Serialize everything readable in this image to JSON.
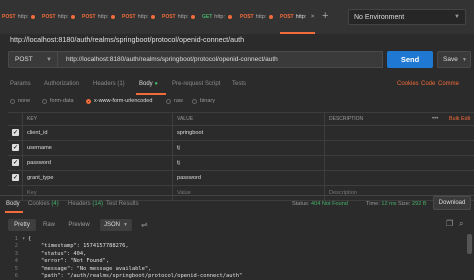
{
  "tabs": [
    {
      "method": "POST",
      "label": "http:"
    },
    {
      "method": "POST",
      "label": "http:"
    },
    {
      "method": "POST",
      "label": "http:"
    },
    {
      "method": "POST",
      "label": "http:"
    },
    {
      "method": "POST",
      "label": "http:"
    },
    {
      "method": "GET",
      "label": "http:"
    },
    {
      "method": "POST",
      "label": "http:"
    },
    {
      "method": "POST",
      "label": "http:"
    }
  ],
  "environment": "No Environment",
  "request_title": "http://localhost:8180/auth/realms/springboot/protocol/openid-connect/auth",
  "request": {
    "method": "POST",
    "url": "http://localhost:8180/auth/realms/springboot/protocol/openid-connect/auth",
    "send_label": "Send",
    "save_label": "Save"
  },
  "request_tabs": {
    "params": "Params",
    "authorization": "Authorization",
    "headers": "Headers (1)",
    "body": "Body",
    "prerequest": "Pre-request Script",
    "tests": "Tests",
    "cookies": "Cookies",
    "code": "Code",
    "comments": "Comme"
  },
  "body_types": [
    "none",
    "form-data",
    "x-www-form-urlencoded",
    "raw",
    "binary"
  ],
  "table": {
    "headers": {
      "key": "KEY",
      "value": "VALUE",
      "description": "DESCRIPTION",
      "more": "•••",
      "bulk": "Bulk Edit"
    },
    "rows": [
      {
        "key": "client_id",
        "value": "springboot",
        "description": ""
      },
      {
        "key": "username",
        "value": "tj",
        "description": ""
      },
      {
        "key": "password",
        "value": "tj",
        "description": ""
      },
      {
        "key": "grant_type",
        "value": "password",
        "description": ""
      }
    ],
    "placeholder": {
      "key": "Key",
      "value": "Value",
      "description": "Description"
    }
  },
  "response_tabs": {
    "body": "Body",
    "cookies": "Cookies",
    "cookies_count": "(4)",
    "headers": "Headers",
    "headers_count": "(14)",
    "tests": "Test Results"
  },
  "status": {
    "status_label": "Status:",
    "status_value": "404 Not Found",
    "time_label": "Time:",
    "time_value": "12 ms",
    "size_label": "Size:",
    "size_value": "292 B",
    "download": "Download"
  },
  "view": {
    "pretty": "Pretty",
    "raw": "Raw",
    "preview": "Preview",
    "format": "JSON"
  },
  "code_lines": [
    {
      "n": "1",
      "text": "{"
    },
    {
      "n": "2",
      "text": "    \"timestamp\": 1574157788276,"
    },
    {
      "n": "3",
      "text": "    \"status\": 404,"
    },
    {
      "n": "4",
      "text": "    \"error\": \"Not Found\","
    },
    {
      "n": "5",
      "text": "    \"message\": \"No message available\","
    },
    {
      "n": "6",
      "text": "    \"path\": \"/auth/realms/springboot/protocol/openid-connect/auth\""
    }
  ],
  "colors": {
    "accent": "#f26b3a",
    "send": "#1f78d1",
    "ok_text": "#47b06a"
  }
}
